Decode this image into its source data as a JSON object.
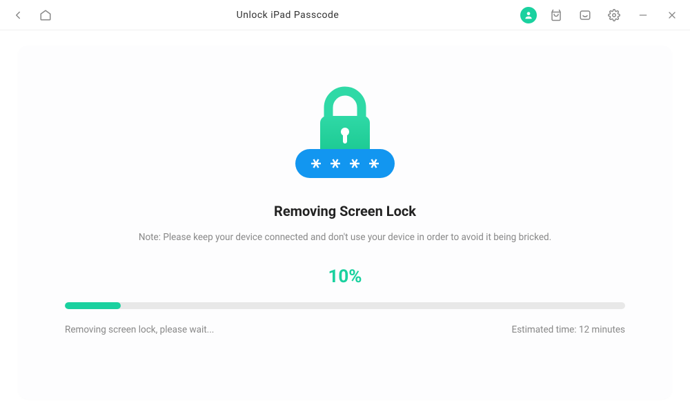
{
  "titlebar": {
    "title": "Unlock iPad Passcode"
  },
  "main": {
    "heading": "Removing Screen Lock",
    "note": "Note: Please keep your device connected and don't use your device in order to avoid it being bricked.",
    "percent_label": "10%",
    "progress_value": 10,
    "status_left": "Removing screen lock, please wait...",
    "status_right": "Estimated time: 12 minutes"
  },
  "colors": {
    "accent": "#1ad19f",
    "pill_blue": "#1296f0"
  }
}
